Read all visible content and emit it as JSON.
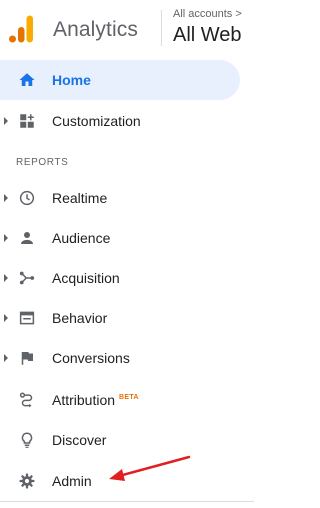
{
  "header": {
    "app_name": "Analytics",
    "account_label": "All accounts",
    "account_caret": ">",
    "account_name": "All Web"
  },
  "nav": {
    "items": [
      {
        "label": "Home",
        "icon": "home-icon",
        "active": true
      },
      {
        "label": "Customization",
        "icon": "dashboard-icon",
        "expandable": true
      },
      {
        "label": "Realtime",
        "icon": "clock-icon",
        "expandable": true
      },
      {
        "label": "Audience",
        "icon": "person-icon",
        "expandable": true
      },
      {
        "label": "Acquisition",
        "icon": "acquisition-icon",
        "expandable": true
      },
      {
        "label": "Behavior",
        "icon": "behavior-icon",
        "expandable": true
      },
      {
        "label": "Conversions",
        "icon": "flag-icon",
        "expandable": true
      },
      {
        "label": "Attribution",
        "icon": "attribution-icon",
        "badge": "BETA"
      },
      {
        "label": "Discover",
        "icon": "lightbulb-icon"
      },
      {
        "label": "Admin",
        "icon": "gear-icon"
      }
    ],
    "section_reports": "REPORTS"
  },
  "colors": {
    "accent": "#1a73e8",
    "active_bg": "#e8f0fe",
    "beta": "#e8710a",
    "annotation_arrow": "#e02020",
    "logo_orange": "#f9ab00",
    "logo_dark_orange": "#e37400"
  }
}
